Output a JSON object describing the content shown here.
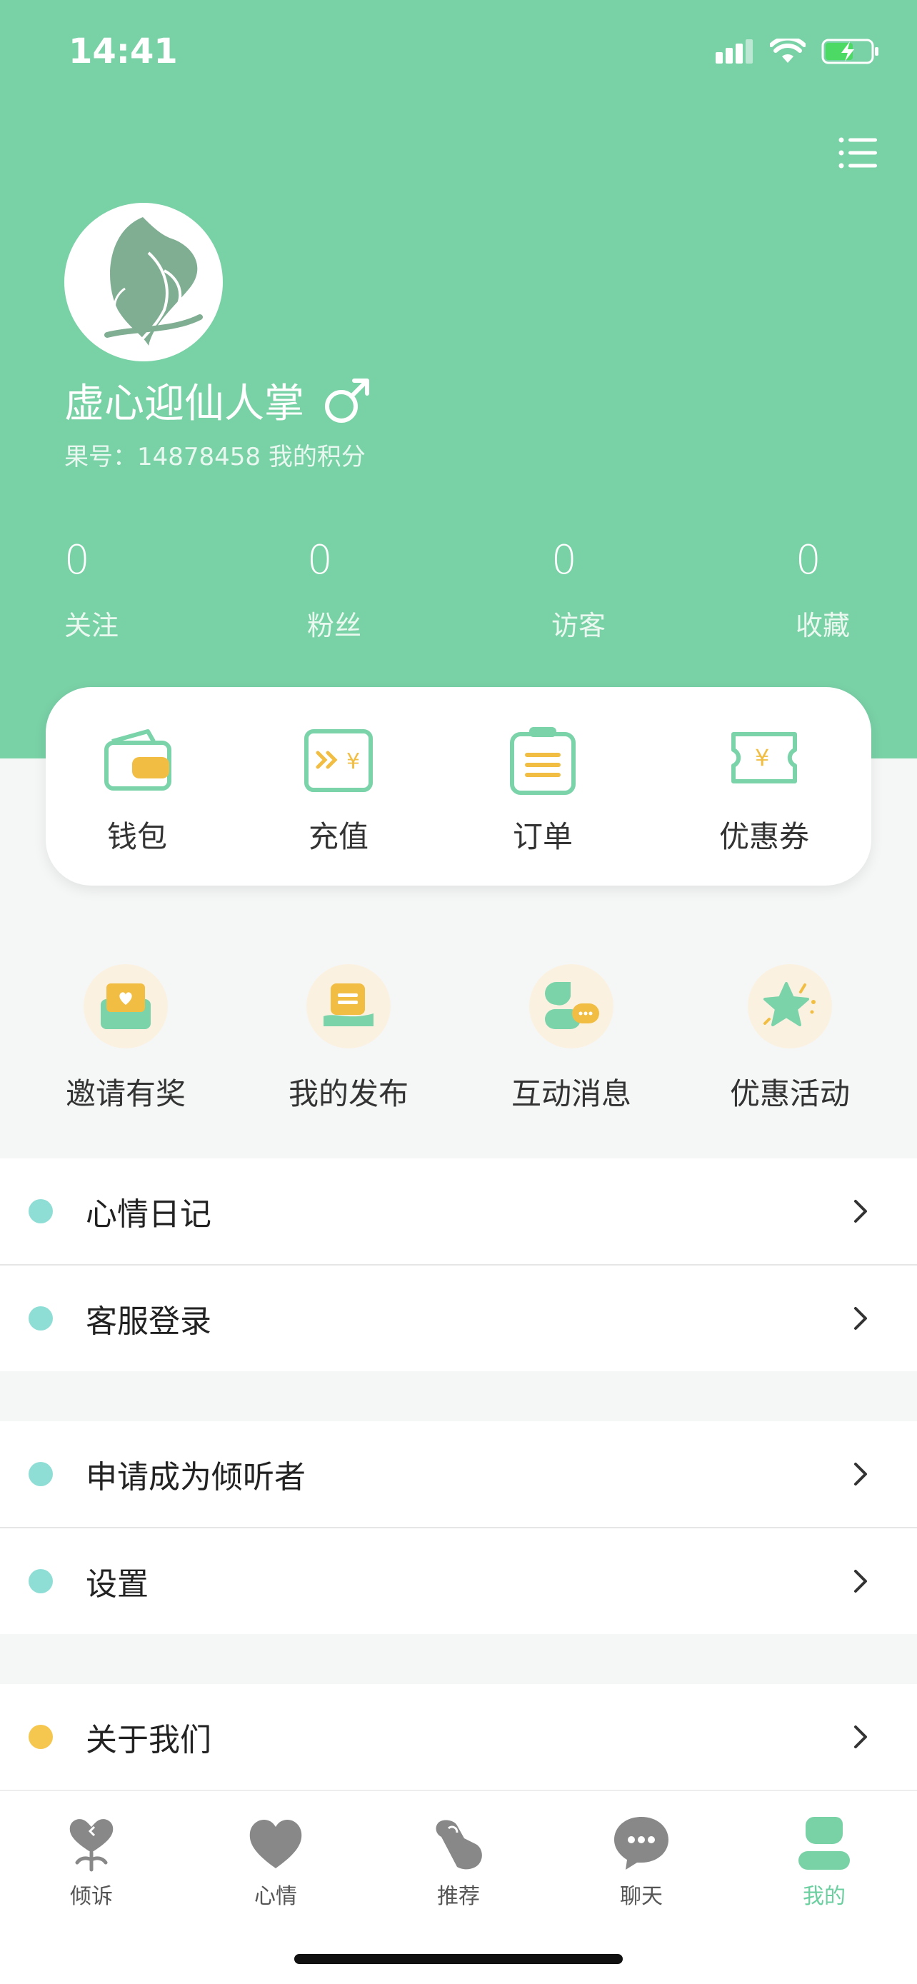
{
  "status_bar": {
    "time": "14:41"
  },
  "profile": {
    "name": "虚心迎仙人掌",
    "gender_symbol": "♂",
    "meta": "果号：14878458 我的积分"
  },
  "stats": [
    {
      "value": "0",
      "label": "关注"
    },
    {
      "value": "0",
      "label": "粉丝"
    },
    {
      "value": "0",
      "label": "访客"
    },
    {
      "value": "0",
      "label": "收藏"
    }
  ],
  "actions": [
    {
      "label": "钱包",
      "icon": "wallet-icon"
    },
    {
      "label": "充值",
      "icon": "recharge-icon"
    },
    {
      "label": "订单",
      "icon": "order-icon"
    },
    {
      "label": "优惠券",
      "icon": "coupon-icon"
    }
  ],
  "quick_links": [
    {
      "label": "邀请有奖",
      "icon": "invite-gift-icon"
    },
    {
      "label": "我的发布",
      "icon": "my-post-icon"
    },
    {
      "label": "互动消息",
      "icon": "interaction-message-icon"
    },
    {
      "label": "优惠活动",
      "icon": "promotion-star-icon"
    }
  ],
  "menu": [
    {
      "label": "心情日记",
      "dot_color": "#8fded6"
    },
    {
      "label": "客服登录",
      "dot_color": "#8fded6"
    },
    {
      "label": "申请成为倾听者",
      "dot_color": "#8fded6"
    },
    {
      "label": "设置",
      "dot_color": "#8fded6"
    },
    {
      "label": "关于我们",
      "dot_color": "#f6c74e"
    }
  ],
  "tabs": [
    {
      "label": "倾诉",
      "icon": "confide-heart-icon"
    },
    {
      "label": "心情",
      "icon": "mood-heart-icon"
    },
    {
      "label": "推荐",
      "icon": "finger-heart-icon"
    },
    {
      "label": "聊天",
      "icon": "chat-bubble-icon"
    },
    {
      "label": "我的",
      "icon": "user-icon",
      "active": true
    }
  ],
  "colors": {
    "brand_green": "#79d1a6",
    "accent_yellow": "#f1be43",
    "tab_active": "#6ccfa0"
  }
}
